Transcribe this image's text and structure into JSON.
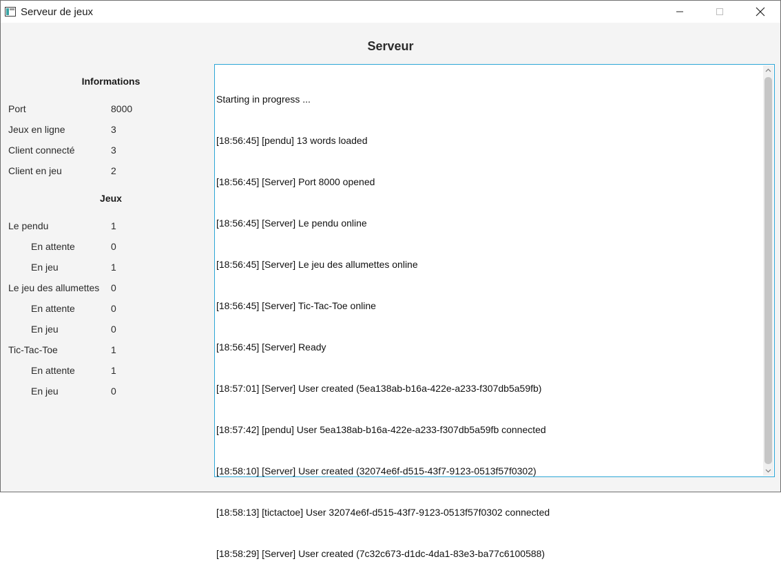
{
  "window": {
    "title": "Serveur de jeux",
    "icons": {
      "app": "window-app-icon",
      "minimize": "minimize-icon",
      "maximize": "maximize-icon",
      "close": "close-icon"
    }
  },
  "page": {
    "title": "Serveur"
  },
  "info": {
    "title": "Informations",
    "rows": [
      {
        "label": "Port",
        "value": "8000"
      },
      {
        "label": "Jeux en ligne",
        "value": "3"
      },
      {
        "label": "Client connecté",
        "value": "3"
      },
      {
        "label": "Client en jeu",
        "value": "2"
      }
    ]
  },
  "games": {
    "title": "Jeux",
    "rows": [
      {
        "label": "Le pendu",
        "value": "1"
      },
      {
        "label": "En attente",
        "value": "0"
      },
      {
        "label": "En jeu",
        "value": "1"
      },
      {
        "label": "Le jeu des allumettes",
        "value": "0"
      },
      {
        "label": "En attente",
        "value": "0"
      },
      {
        "label": "En jeu",
        "value": "0"
      },
      {
        "label": "Tic-Tac-Toe",
        "value": "1"
      },
      {
        "label": "En attente",
        "value": "1"
      },
      {
        "label": "En jeu",
        "value": "0"
      }
    ]
  },
  "log": {
    "lines": [
      "Starting in progress ...",
      "[18:56:45] [pendu] 13 words loaded",
      "[18:56:45] [Server] Port 8000 opened",
      "[18:56:45] [Server] Le pendu online",
      "[18:56:45] [Server] Le jeu des allumettes online",
      "[18:56:45] [Server] Tic-Tac-Toe online",
      "[18:56:45] [Server] Ready",
      "[18:57:01] [Server] User created (5ea138ab-b16a-422e-a233-f307db5a59fb)",
      "[18:57:42] [pendu] User 5ea138ab-b16a-422e-a233-f307db5a59fb connected",
      "[18:58:10] [Server] User created (32074e6f-d515-43f7-9123-0513f57f0302)",
      "[18:58:13] [tictactoe] User 32074e6f-d515-43f7-9123-0513f57f0302 connected",
      "[18:58:29] [Server] User created (7c32c673-d1dc-4da1-83e3-ba77c6100588)"
    ]
  },
  "colors": {
    "log_border": "#2ba5d6",
    "background": "#f4f4f4"
  }
}
